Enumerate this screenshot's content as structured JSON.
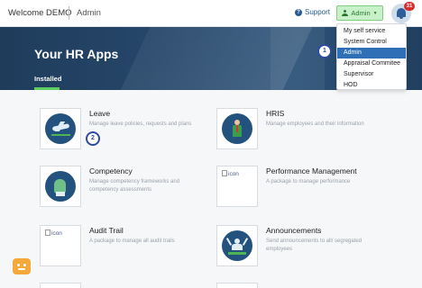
{
  "header": {
    "welcome": "Welcome DEMO",
    "crumb": "Admin",
    "support_label": "Support",
    "admin_button": "Admin",
    "notification_count": "31"
  },
  "hero": {
    "title": "Your HR Apps",
    "tab": "Installed"
  },
  "dropdown": {
    "items": [
      "My self service",
      "System Control",
      "Admin",
      "Appraisal Commitee",
      "Supervisor",
      "HOD"
    ],
    "selected": "Admin"
  },
  "steps": [
    "1",
    "2"
  ],
  "apps": [
    {
      "title": "Leave",
      "desc": "Manage leave policies, requests and plans",
      "icon": "airplane-icon"
    },
    {
      "title": "HRIS",
      "desc": "Manage employees and their information",
      "icon": "employee-icon"
    },
    {
      "title": "Competency",
      "desc": "Manage competency frameworks and competency assessments",
      "icon": "hand-icon"
    },
    {
      "title": "Performance Management",
      "desc": "A package to manage performance",
      "icon": "broken-image-icon",
      "alt": "icon"
    },
    {
      "title": "Audit Trail",
      "desc": "A package to manage all audit trails",
      "icon": "broken-image-icon",
      "alt": "icon"
    },
    {
      "title": "Announcements",
      "desc": "Send announcements to all/ segregated employees",
      "icon": "announcement-icon"
    }
  ],
  "colors": {
    "hero": "#27496d",
    "accent_green": "#5dcf62",
    "icon_circle": "#23527f",
    "dropdown_active": "#2f6fb5"
  }
}
